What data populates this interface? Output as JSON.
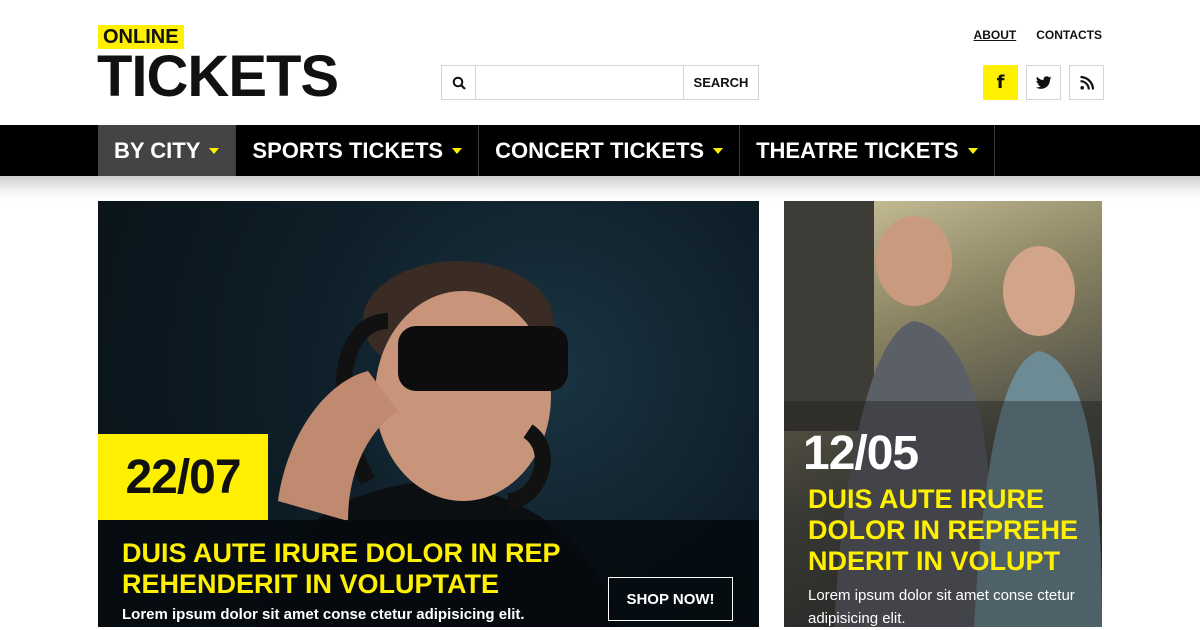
{
  "logo": {
    "online": "ONLINE",
    "tickets": "TICKETS"
  },
  "search": {
    "placeholder": "",
    "button": "SEARCH"
  },
  "toplinks": [
    "ABOUT",
    "CONTACTS"
  ],
  "social": {
    "facebook": "f",
    "twitter": "twitter-icon",
    "rss": "rss-icon"
  },
  "nav": [
    {
      "label": "BY CITY"
    },
    {
      "label": "SPORTS TICKETS"
    },
    {
      "label": "CONCERT TICKETS"
    },
    {
      "label": "THEATRE TICKETS"
    }
  ],
  "main_card": {
    "date": "22/07",
    "title": "DUIS AUTE IRURE DOLOR IN REP REHENDERIT IN VOLUPTATE",
    "text": "Lorem ipsum dolor sit amet conse ctetur adipisicing elit.",
    "button": "SHOP NOW!"
  },
  "side_card": {
    "date": "12/05",
    "title": "DUIS AUTE IRURE DOLOR IN REPREHE NDERIT IN VOLUPT",
    "text": "Lorem ipsum dolor sit amet conse ctetur adipisicing elit."
  },
  "colors": {
    "accent": "#ffef00",
    "nav_bg": "#000000",
    "nav_active": "#444444"
  }
}
